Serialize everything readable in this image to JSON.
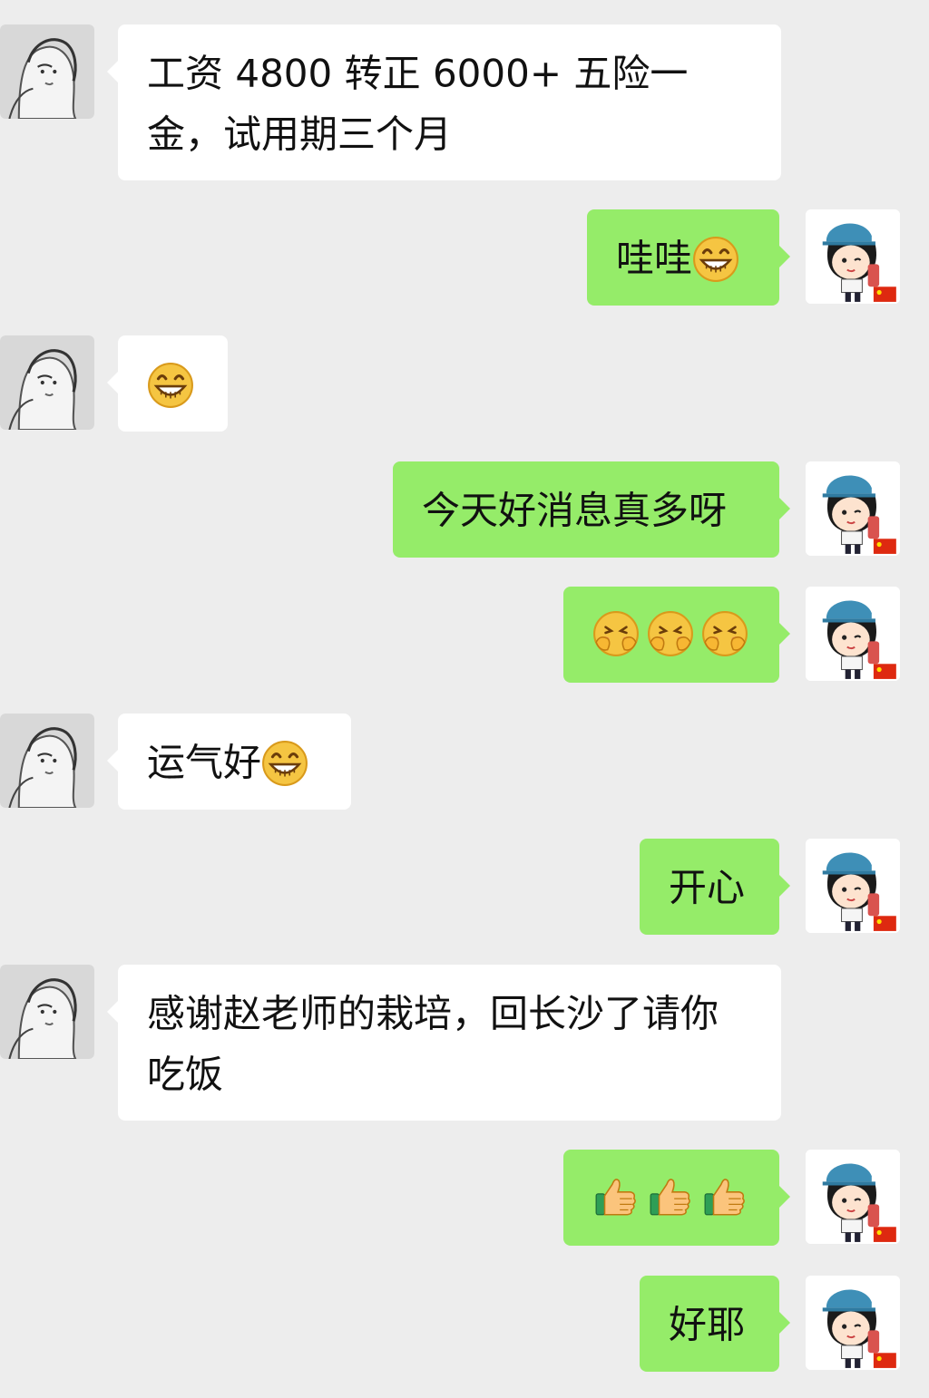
{
  "chat": {
    "messages": [
      {
        "side": "in",
        "text": "工资 4800 转正 6000+ 五险一金，试用期三个月"
      },
      {
        "side": "out",
        "text": "哇哇",
        "emoji": "grin-emoji"
      },
      {
        "side": "in",
        "emoji": "grin-emoji"
      },
      {
        "side": "out",
        "text": "今天好消息真多呀"
      },
      {
        "side": "out",
        "emojis": [
          "shy-cover-face-emoji",
          "shy-cover-face-emoji",
          "shy-cover-face-emoji"
        ]
      },
      {
        "side": "in",
        "text": "运气好",
        "emoji": "grin-emoji"
      },
      {
        "side": "out",
        "text": "开心"
      },
      {
        "side": "in",
        "text": "感谢赵老师的栽培，回长沙了请你吃饭"
      },
      {
        "side": "out",
        "emojis": [
          "thumbs-up-emoji",
          "thumbs-up-emoji",
          "thumbs-up-emoji"
        ]
      },
      {
        "side": "out",
        "text": "好耶"
      }
    ]
  },
  "colors": {
    "background": "#ededed",
    "incoming_bubble": "#ffffff",
    "outgoing_bubble": "#95ec69"
  },
  "icons": {
    "contact_avatar": "sketch-girls-avatar",
    "self_avatar": "cartoon-girl-cap-flag-avatar"
  }
}
